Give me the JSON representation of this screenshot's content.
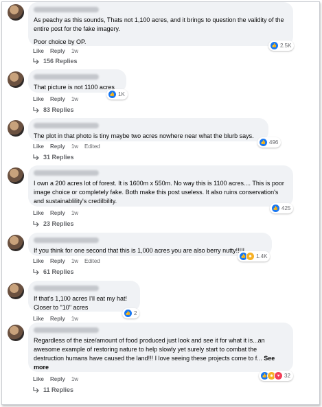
{
  "action_labels": {
    "like": "Like",
    "reply": "Reply",
    "edited": "Edited"
  },
  "comments": [
    {
      "paragraphs": [
        "As peachy as this sounds, Thats not 1,100 acres, and it brings to question the validity of the entire post for the fake imagery.",
        "Poor choice by OP."
      ],
      "reaction_count": "2.5K",
      "reactions": [
        "like"
      ],
      "time": "1w",
      "edited": false,
      "replies": "156 Replies"
    },
    {
      "paragraphs": [
        "That picture is not 1100 acres"
      ],
      "reaction_count": "1K",
      "reactions": [
        "like"
      ],
      "time": "1w",
      "edited": false,
      "replies": "83 Replies"
    },
    {
      "paragraphs": [
        "The plot in that photo is tiny maybe two acres nowhere near what the blurb says."
      ],
      "reaction_count": "496",
      "reactions": [
        "like"
      ],
      "time": "1w",
      "edited": true,
      "replies": "31 Replies"
    },
    {
      "paragraphs": [
        "I own a 200 acres lot of forest. It is 1600m x 550m. No way this is 1100 acres.... This is poor image choice or completely fake. Both make this post useless. It also ruins conservation's and sustainablility's credilbility."
      ],
      "reaction_count": "425",
      "reactions": [
        "like"
      ],
      "time": "1w",
      "edited": false,
      "replies": "23 Replies"
    },
    {
      "paragraphs": [
        "If you think for one second that this is 1,000 acres you are also berry nutty!!!!!"
      ],
      "reaction_count": "1.4K",
      "reactions": [
        "like",
        "haha"
      ],
      "time": "1w",
      "edited": true,
      "replies": "61 Replies"
    },
    {
      "paragraphs": [
        "If that's 1,100 acres I'll eat my hat!\nCloser to \"10\" acres"
      ],
      "reaction_count": "2",
      "reactions": [
        "like"
      ],
      "time": "1w",
      "edited": false,
      "replies": null
    },
    {
      "paragraphs": [
        "Regardless of the size/amount of food produced just look and see it for what it is...an awesome example of restoring nature to help slowly yet surely start to combat the destruction humans have caused the land!!! I love seeing these projects come to f..."
      ],
      "see_more": "See more",
      "reaction_count": "32",
      "reactions": [
        "like",
        "haha",
        "love"
      ],
      "time": "1w",
      "edited": false,
      "replies": "11 Replies"
    }
  ],
  "colors": {
    "like": "#1877f2",
    "haha": "#f7b125",
    "love": "#f33e58",
    "bubble": "#f0f2f5",
    "meta": "#65676b"
  }
}
